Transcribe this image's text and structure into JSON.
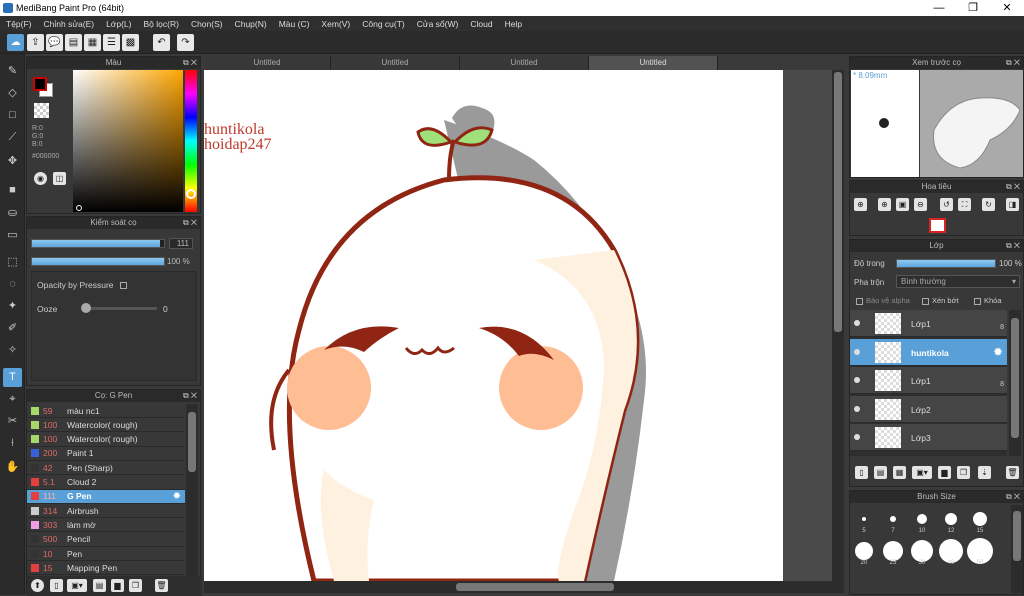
{
  "window": {
    "title": "MediBang Paint Pro (64bit)",
    "minimize": "—",
    "restore": "❐",
    "close": "✕"
  },
  "menu": [
    "Tệp(F)",
    "Chỉnh sửa(E)",
    "Lớp(L)",
    "Bộ lọc(R)",
    "Chọn(S)",
    "Chụp(N)",
    "Màu (C)",
    "Xem(V)",
    "Công cụ(T)",
    "Cửa sổ(W)",
    "Cloud",
    "Help"
  ],
  "tabs": [
    "Untitled",
    "Untitled",
    "Untitled",
    "Untitled"
  ],
  "color_panel": {
    "title": "Màu",
    "r": "R:0",
    "g": "G:0",
    "b": "B:0",
    "hex": "#000000",
    "foreground": "#000000",
    "accent": "#cc0000"
  },
  "brush_control": {
    "title": "Kiểm soát cọ",
    "size": "111",
    "size_fraction": 0.97,
    "opacity": "100 %",
    "opacity_fraction": 1.0,
    "opacity_pressure_label": "Opacity by Pressure",
    "ooze_label": "Ooze",
    "ooze_value": "0"
  },
  "brush_list": {
    "title": "Cọ: G Pen",
    "items": [
      {
        "size": "59",
        "name": "màu nc1",
        "color": "#a6d86a"
      },
      {
        "size": "100",
        "name": "Watercolor( rough)",
        "color": "#a6d86a"
      },
      {
        "size": "100",
        "name": "Watercolor( rough)",
        "color": "#a6d86a"
      },
      {
        "size": "200",
        "name": "Paint 1",
        "color": "#3a60d8"
      },
      {
        "size": "42",
        "name": "Pen (Sharp)",
        "color": "#333333"
      },
      {
        "size": "5.1",
        "name": "Cloud 2",
        "color": "#e04040"
      },
      {
        "size": "111",
        "name": "G Pen",
        "color": "#e04040"
      },
      {
        "size": "314",
        "name": "Airbrush",
        "color": "#cccccc"
      },
      {
        "size": "303",
        "name": "làm mờ",
        "color": "#f0a0e0"
      },
      {
        "size": "500",
        "name": "Pencil",
        "color": "#333333"
      },
      {
        "size": "10",
        "name": "Pen",
        "color": "#333333"
      },
      {
        "size": "15",
        "name": "Mapping Pen",
        "color": "#e04040"
      }
    ],
    "selected_index": 6
  },
  "canvas_text": {
    "line1": "huntikola",
    "line2": "hoidap247"
  },
  "preview": {
    "title": "Xem trước cọ",
    "size": "8.09mm"
  },
  "navigator": {
    "title": "Hoa tiêu"
  },
  "layer_panel": {
    "title": "Lớp",
    "opacity_label": "Độ trong",
    "opacity_value": "100 %",
    "opacity_fraction": 1.0,
    "blend_label": "Pha trộn",
    "blend_value": "Bình thường",
    "protect_alpha": "Bảo vệ alpha",
    "clipping": "Xén bớt",
    "lock": "Khóa",
    "layers": [
      {
        "name": "Lớp1",
        "badge": "8"
      },
      {
        "name": "huntikola",
        "badge": ""
      },
      {
        "name": "Lớp1",
        "badge": "8"
      },
      {
        "name": "Lớp2",
        "badge": ""
      },
      {
        "name": "Lớp3",
        "badge": ""
      }
    ],
    "selected_index": 1
  },
  "brush_size": {
    "title": "Brush Size",
    "row1": [
      "5",
      "7",
      "10",
      "12",
      "15"
    ],
    "row2": [
      "20",
      "25",
      "30",
      "40",
      "50"
    ]
  }
}
